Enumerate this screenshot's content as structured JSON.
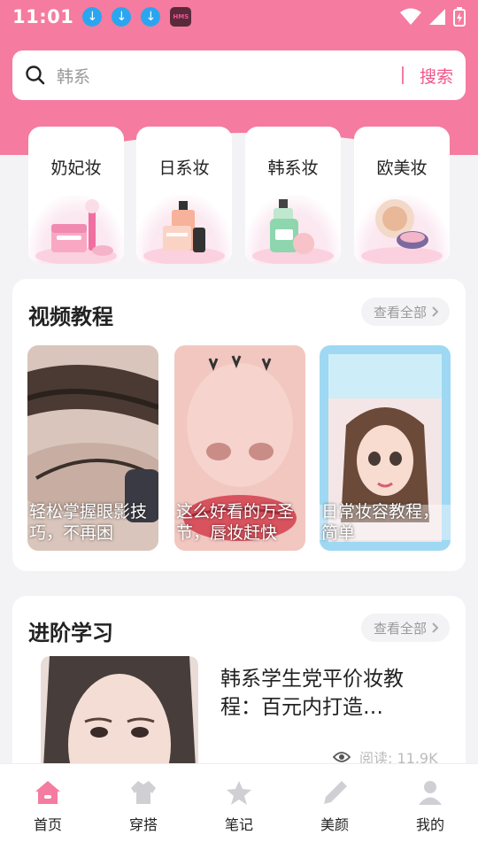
{
  "status": {
    "time": "11:01",
    "hms": "HMS"
  },
  "search": {
    "query": "韩系",
    "button": "搜索"
  },
  "categories": [
    {
      "label": "奶妃妆"
    },
    {
      "label": "日系妆"
    },
    {
      "label": "韩系妆"
    },
    {
      "label": "欧美妆"
    }
  ],
  "video_section": {
    "title": "视频教程",
    "more": "查看全部",
    "videos": [
      {
        "caption": "轻松掌握眼影技巧，不再困"
      },
      {
        "caption": "这么好看的万圣节，唇妆赶快"
      },
      {
        "caption": "日常妆容教程，简单"
      }
    ]
  },
  "advanced_section": {
    "title": "进阶学习",
    "more": "查看全部",
    "article": {
      "title": "韩系学生党平价妆教程：百元内打造…",
      "reads": "阅读: 11.9K"
    }
  },
  "nav": [
    {
      "label": "首页"
    },
    {
      "label": "穿搭"
    },
    {
      "label": "笔记"
    },
    {
      "label": "美颜"
    },
    {
      "label": "我的"
    }
  ],
  "colors": {
    "brand": "#f57ba0",
    "accent": "#f0568a"
  }
}
